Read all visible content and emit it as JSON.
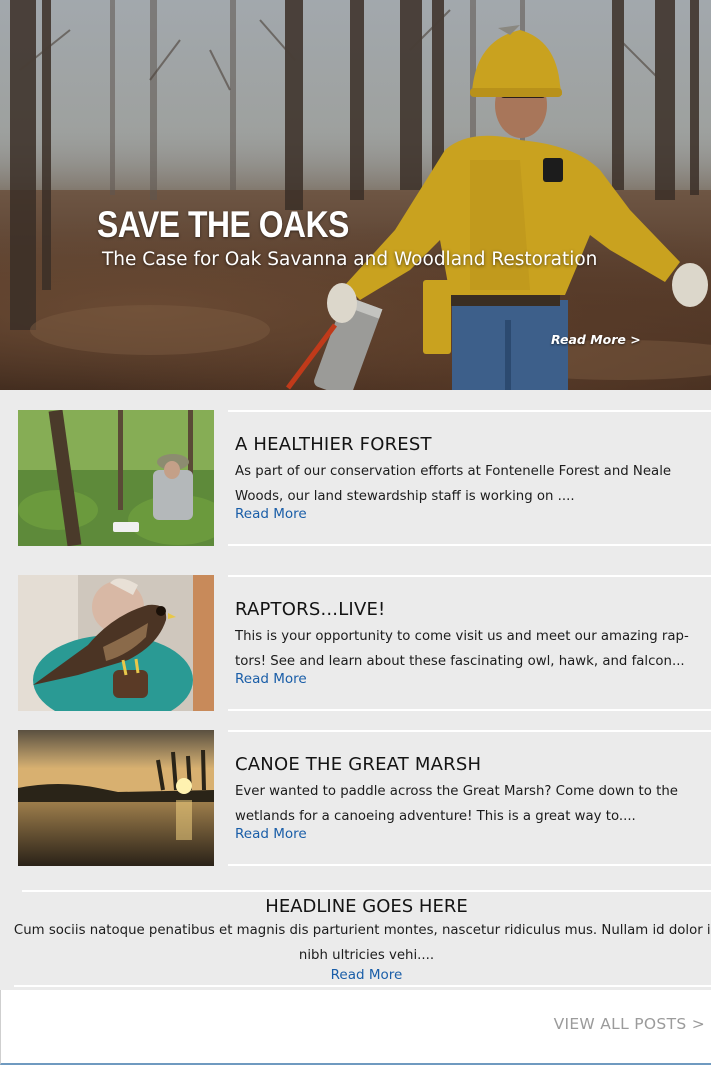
{
  "hero": {
    "title": "SAVE THE OAKS",
    "subtitle": "The Case for Oak Savanna and Woodland Restoration",
    "read_more": "Read More >"
  },
  "posts": [
    {
      "title": "A HEALTHIER FOREST",
      "excerpt": "As part of our conservation efforts at Fontenelle Forest and Neale Woods, our land stewardship staff is working on ....",
      "read_more": "Read More"
    },
    {
      "title": "RAPTORS...LIVE!",
      "excerpt": " This is your opportunity to come visit us and meet our amazing rap-tors! See and learn about these fascinating owl, hawk, and falcon...",
      "read_more": "Read More"
    },
    {
      "title": "CANOE THE GREAT MARSH",
      "excerpt": "Ever wanted to paddle across the Great Marsh? Come down to the wetlands for a canoeing adventure! This is a great way to....",
      "read_more": "Read More"
    }
  ],
  "feature": {
    "title": "HEADLINE GOES HERE",
    "excerpt": "Cum sociis natoque penatibus et magnis dis parturient montes, nascetur ridiculus mus. Nullam id dolor id nibh ultricies vehi....",
    "read_more": "Read More"
  },
  "footer": {
    "view_all": "VIEW ALL POSTS >"
  },
  "colors": {
    "link": "#1a5ea8",
    "panel_bg": "#ebebeb",
    "view_all": "#9b9b9b"
  }
}
